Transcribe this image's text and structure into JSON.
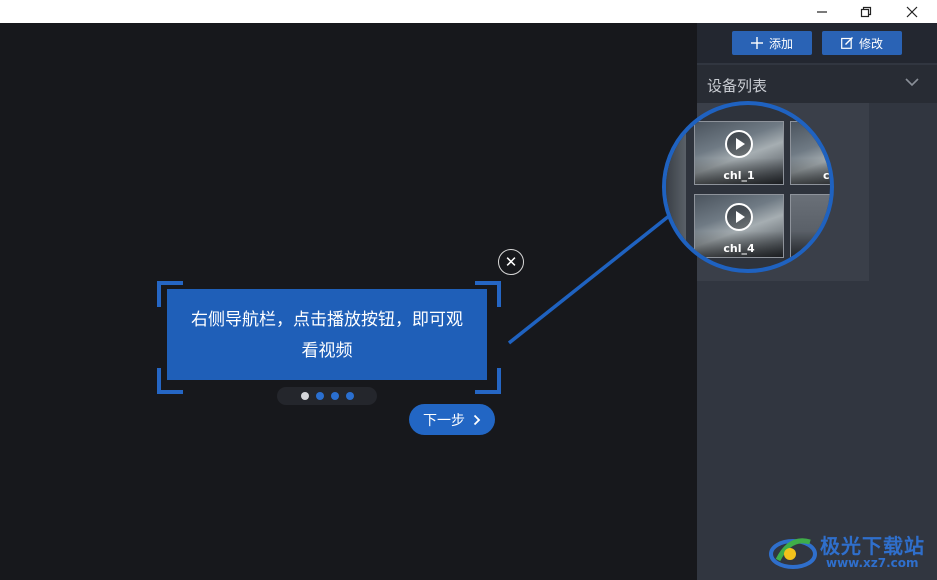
{
  "window_controls": {
    "minimize": "–",
    "restore": "❐",
    "close": "✕"
  },
  "sidebar": {
    "toolbar": {
      "add_label": "添加",
      "edit_label": "修改"
    },
    "device_list_title": "设备列表",
    "channels": [
      {
        "label": "chl_1"
      },
      {
        "label": "ch"
      },
      {
        "label": "chl_4"
      }
    ]
  },
  "guide": {
    "tip_text": "右侧导航栏，点击播放按钮，即可观看视频",
    "step_count": 4,
    "current_step": 1,
    "next_label": "下一步",
    "close_symbol": "✕"
  },
  "watermark": {
    "name": "极光下载站",
    "url": "www.xz7.com"
  },
  "colors": {
    "accent": "#1f5fb8",
    "background": "#17181c",
    "sidebar": "#313640"
  }
}
